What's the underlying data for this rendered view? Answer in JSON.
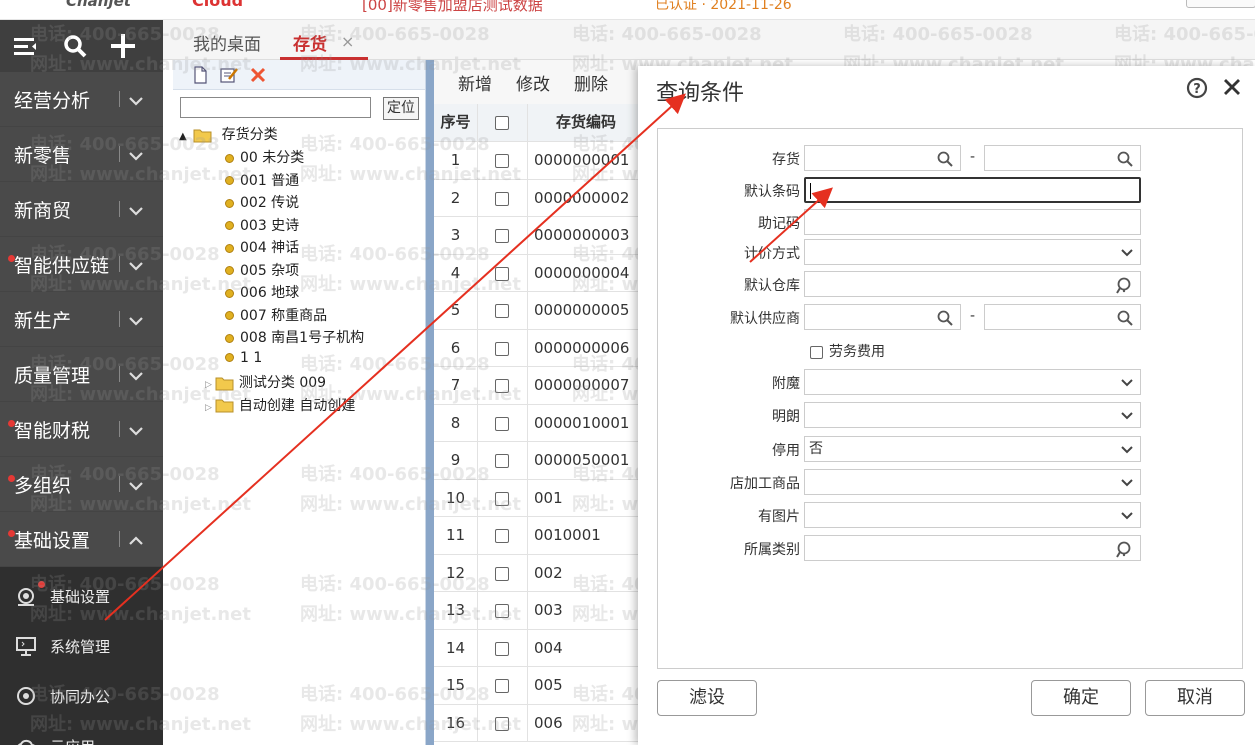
{
  "topbar": {
    "logo": "Chanjet",
    "brand": "Cloud",
    "account": "[00]新零售加盟店测试数据",
    "status": "已认证 · 2021-11-26"
  },
  "sidebar": {
    "menu": [
      {
        "label": "经营分析",
        "dot": false,
        "expanded": false
      },
      {
        "label": "新零售",
        "dot": false,
        "expanded": false
      },
      {
        "label": "新商贸",
        "dot": false,
        "expanded": false
      },
      {
        "label": "智能供应链",
        "dot": true,
        "expanded": false
      },
      {
        "label": "新生产",
        "dot": false,
        "expanded": false
      },
      {
        "label": "质量管理",
        "dot": false,
        "expanded": false
      },
      {
        "label": "智能财税",
        "dot": true,
        "expanded": false
      },
      {
        "label": "多组织",
        "dot": true,
        "expanded": false
      },
      {
        "label": "基础设置",
        "dot": true,
        "expanded": true
      }
    ],
    "submenu": [
      {
        "label": "基础设置",
        "icon": "settings-icon",
        "dot": true
      },
      {
        "label": "系统管理",
        "icon": "monitor-icon",
        "dot": false
      },
      {
        "label": "协同办公",
        "icon": "collab-icon",
        "dot": false
      },
      {
        "label": "云应用",
        "icon": "cloud-icon",
        "dot": false
      }
    ]
  },
  "tabs": {
    "desktop": "我的桌面",
    "inventory": "存货",
    "close": "×"
  },
  "tree": {
    "locate": "定位",
    "search_value": "",
    "root": "存货分类",
    "leaves": [
      "00 未分类",
      "001 普通",
      "002 传说",
      "003 史诗",
      "004 神话",
      "005 杂项",
      "006 地球",
      "007 称重商品",
      "008 南昌1号子机构",
      "1 1"
    ],
    "folders": [
      "测试分类 009",
      "自动创建 自动创建"
    ]
  },
  "grid": {
    "toolbar": [
      "新增",
      "修改",
      "删除"
    ],
    "headers": {
      "seq": "序号",
      "code": "存货编码"
    },
    "rows": [
      {
        "seq": "1",
        "code": "0000000001"
      },
      {
        "seq": "2",
        "code": "0000000002"
      },
      {
        "seq": "3",
        "code": "0000000003"
      },
      {
        "seq": "4",
        "code": "0000000004"
      },
      {
        "seq": "5",
        "code": "0000000005"
      },
      {
        "seq": "6",
        "code": "0000000006"
      },
      {
        "seq": "7",
        "code": "0000000007"
      },
      {
        "seq": "8",
        "code": "0000010001"
      },
      {
        "seq": "9",
        "code": "0000050001"
      },
      {
        "seq": "10",
        "code": "001"
      },
      {
        "seq": "11",
        "code": "0010001"
      },
      {
        "seq": "12",
        "code": "002"
      },
      {
        "seq": "13",
        "code": "003"
      },
      {
        "seq": "14",
        "code": "004"
      },
      {
        "seq": "15",
        "code": "005"
      },
      {
        "seq": "16",
        "code": "006"
      }
    ]
  },
  "dialog": {
    "title": "查询条件",
    "help": "?",
    "close": "×",
    "fields": {
      "inventory": "存货",
      "barcode": "默认条码",
      "mnemonic": "助记码",
      "pricing": "计价方式",
      "warehouse": "默认仓库",
      "supplier": "默认供应商",
      "labor": "劳务费用",
      "attach": "附魔",
      "clear": "明朗",
      "disabled": "停用",
      "disabled_value": "否",
      "processed": "店加工商品",
      "has_image": "有图片",
      "category": "所属类别"
    },
    "dash": "-",
    "buttons": {
      "filter": "滤设",
      "ok": "确定",
      "cancel": "取消"
    }
  },
  "watermark": {
    "phone": "电话: 400-665-0028",
    "site": "网址: www.chanjet.net"
  },
  "colors": {
    "accent": "#c93030",
    "sidebar": "#4a4a4a",
    "arrow": "#e53020"
  }
}
